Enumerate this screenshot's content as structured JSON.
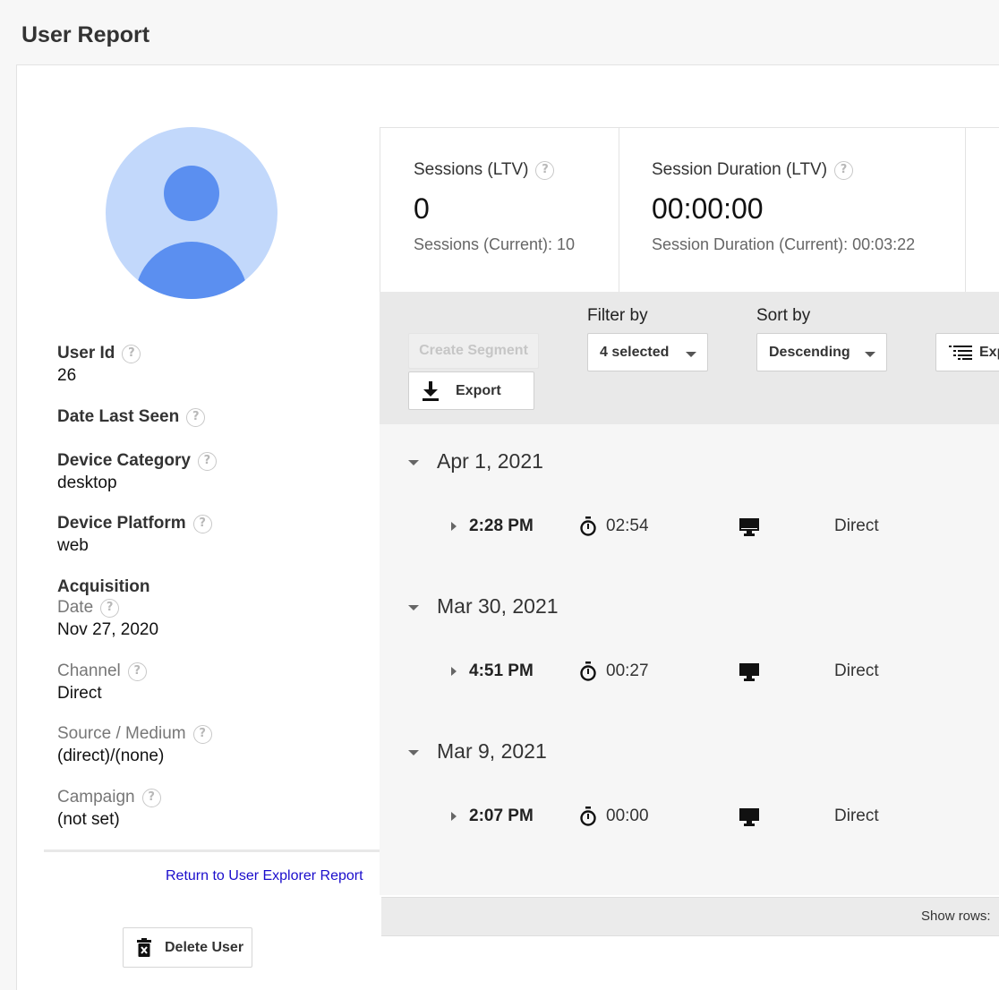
{
  "page": {
    "title": "User Report"
  },
  "profile": {
    "user_id_label": "User Id",
    "user_id": "26",
    "date_last_seen_label": "Date Last Seen",
    "device_category_label": "Device Category",
    "device_category": "desktop",
    "device_platform_label": "Device Platform",
    "device_platform": "web",
    "acquisition_label": "Acquisition",
    "acq_date_label": "Date",
    "acq_date": "Nov 27, 2020",
    "channel_label": "Channel",
    "channel": "Direct",
    "source_medium_label": "Source / Medium",
    "source_medium": "(direct)/(none)",
    "campaign_label": "Campaign",
    "campaign": "(not set)"
  },
  "help_glyph": "?",
  "links": {
    "return": "Return to User Explorer Report"
  },
  "actions": {
    "delete_user": "Delete User"
  },
  "metrics": [
    {
      "label": "Sessions (LTV)",
      "value": "0",
      "current": "Sessions (Current): 10"
    },
    {
      "label": "Session Duration (LTV)",
      "value": "00:00:00",
      "current": "Session Duration (Current): 00:03:22"
    }
  ],
  "toolbar": {
    "create_segment": "Create Segment",
    "export": "Export",
    "filter_label": "Filter by",
    "filter_value": "4 selected",
    "sort_label": "Sort by",
    "sort_value": "Descending",
    "expand_label": "Exp"
  },
  "sessions": [
    {
      "date": "Apr 1, 2021",
      "time": "2:28 PM",
      "duration": "02:54",
      "device_icon": "desktop-icon",
      "channel": "Direct"
    },
    {
      "date": "Mar 30, 2021",
      "time": "4:51 PM",
      "duration": "00:27",
      "device_icon": "desktop-icon",
      "channel": "Direct"
    },
    {
      "date": "Mar 9, 2021",
      "time": "2:07 PM",
      "duration": "00:00",
      "device_icon": "desktop-icon",
      "channel": "Direct"
    }
  ],
  "footer": {
    "show_rows": "Show rows:"
  },
  "colors": {
    "avatar_bg": "#c2d8fb",
    "avatar_fg": "#5b8ff0",
    "link": "#1a0dcc"
  }
}
